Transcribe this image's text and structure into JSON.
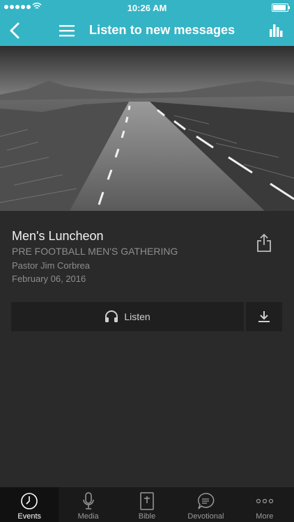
{
  "status": {
    "time": "10:26 AM"
  },
  "nav": {
    "title": "Listen to new messages"
  },
  "message": {
    "title": "Men's Luncheon",
    "series": "PRE FOOTBALL MEN'S GATHERING",
    "speaker": "Pastor Jim Corbrea",
    "date": "February 06, 2016"
  },
  "actions": {
    "listen_label": "Listen"
  },
  "tabs": [
    {
      "label": "Events",
      "icon": "clock-icon"
    },
    {
      "label": "Media",
      "icon": "microphone-icon"
    },
    {
      "label": "Bible",
      "icon": "bible-icon"
    },
    {
      "label": "Devotional",
      "icon": "speech-bubble-icon"
    },
    {
      "label": "More",
      "icon": "more-dots-icon"
    }
  ],
  "colors": {
    "accent": "#35b4c5",
    "background": "#2a2a2a",
    "tabbar": "#1a1a1a"
  }
}
